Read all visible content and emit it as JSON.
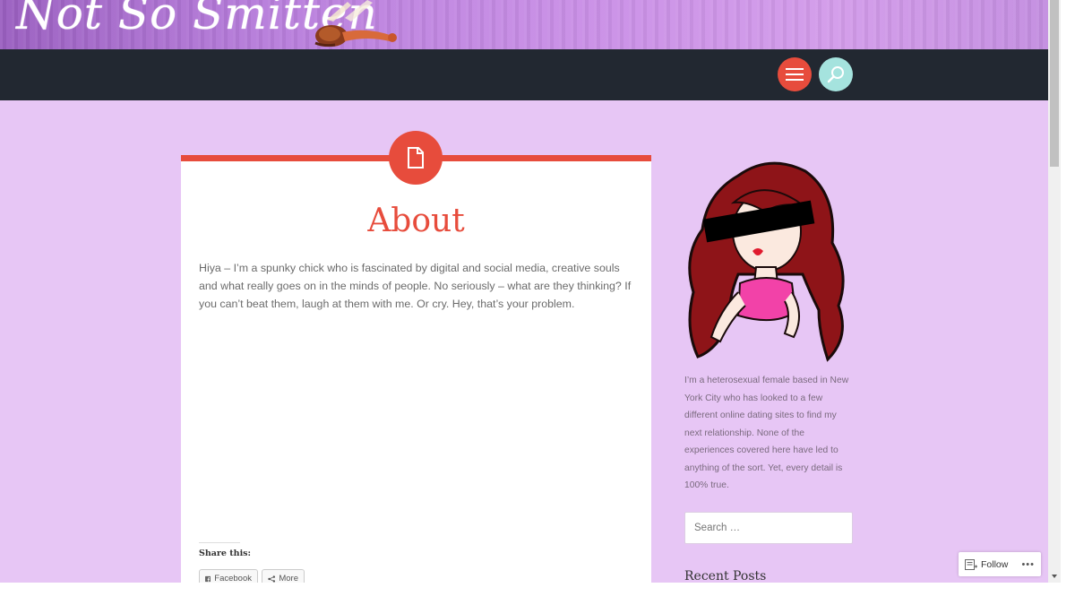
{
  "site": {
    "title": "Not So Smitten"
  },
  "nav": {
    "menu_icon": "hamburger-menu-icon",
    "search_icon": "search-icon"
  },
  "article": {
    "badge_icon": "page-icon",
    "title": "About",
    "body": "Hiya – I’m a spunky chick who is fascinated by digital and social media, creative souls and what really goes on in the minds of people.  No seriously – what are they thinking?  If you can’t beat them, laugh at them with me.  Or cry.  Hey, that’s your problem.",
    "share_label": "Share this:",
    "share_buttons": {
      "facebook": "Facebook",
      "more": "More"
    }
  },
  "sidebar": {
    "bio": "I’m a heterosexual female based in New York City who has looked to a few different online dating sites to find my next relationship. None of the experiences covered here have led to anything of the sort. Yet, every detail is 100% true.",
    "search_placeholder": "Search …",
    "recent_posts_heading": "Recent Posts"
  },
  "follow_widget": {
    "label": "Follow",
    "more": "•••"
  },
  "colors": {
    "accent": "#e74c3c",
    "search_circle": "#a5e3de",
    "navbar": "#222831",
    "page_background": "#e7c6f5"
  }
}
